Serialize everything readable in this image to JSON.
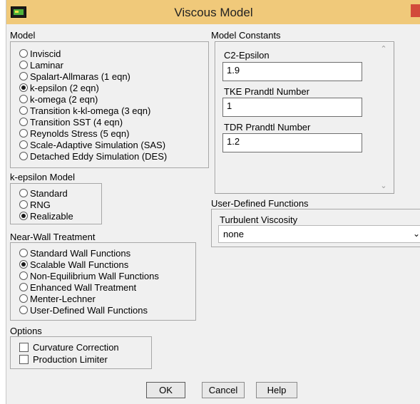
{
  "window": {
    "title": "Viscous Model"
  },
  "model": {
    "label": "Model",
    "options": [
      {
        "label": "Inviscid",
        "selected": false
      },
      {
        "label": "Laminar",
        "selected": false
      },
      {
        "label": "Spalart-Allmaras (1 eqn)",
        "selected": false
      },
      {
        "label": "k-epsilon (2 eqn)",
        "selected": true
      },
      {
        "label": "k-omega (2 eqn)",
        "selected": false
      },
      {
        "label": "Transition k-kl-omega (3 eqn)",
        "selected": false
      },
      {
        "label": "Transition SST (4 eqn)",
        "selected": false
      },
      {
        "label": "Reynolds Stress (5 eqn)",
        "selected": false
      },
      {
        "label": "Scale-Adaptive Simulation (SAS)",
        "selected": false
      },
      {
        "label": "Detached Eddy Simulation (DES)",
        "selected": false
      }
    ]
  },
  "kepsilon": {
    "label": "k-epsilon Model",
    "options": [
      {
        "label": "Standard",
        "selected": false
      },
      {
        "label": "RNG",
        "selected": false
      },
      {
        "label": "Realizable",
        "selected": true
      }
    ]
  },
  "nearwall": {
    "label": "Near-Wall Treatment",
    "options": [
      {
        "label": "Standard Wall Functions",
        "selected": false
      },
      {
        "label": "Scalable Wall Functions",
        "selected": true
      },
      {
        "label": "Non-Equilibrium Wall Functions",
        "selected": false
      },
      {
        "label": "Enhanced Wall Treatment",
        "selected": false
      },
      {
        "label": "Menter-Lechner",
        "selected": false
      },
      {
        "label": "User-Defined Wall Functions",
        "selected": false
      }
    ]
  },
  "options": {
    "label": "Options",
    "items": [
      {
        "label": "Curvature Correction",
        "checked": false
      },
      {
        "label": "Production Limiter",
        "checked": false
      }
    ]
  },
  "constants": {
    "label": "Model Constants",
    "fields": [
      {
        "label": "C2-Epsilon",
        "value": "1.9"
      },
      {
        "label": "TKE Prandtl Number",
        "value": "1"
      },
      {
        "label": "TDR Prandtl Number",
        "value": "1.2"
      }
    ]
  },
  "udf": {
    "label": "User-Defined Functions",
    "turb_label": "Turbulent Viscosity",
    "turb_value": "none"
  },
  "buttons": {
    "ok": "OK",
    "cancel": "Cancel",
    "help": "Help"
  },
  "colors": {
    "titlebar": "#f0c97a",
    "panel": "#f0f0f0"
  }
}
